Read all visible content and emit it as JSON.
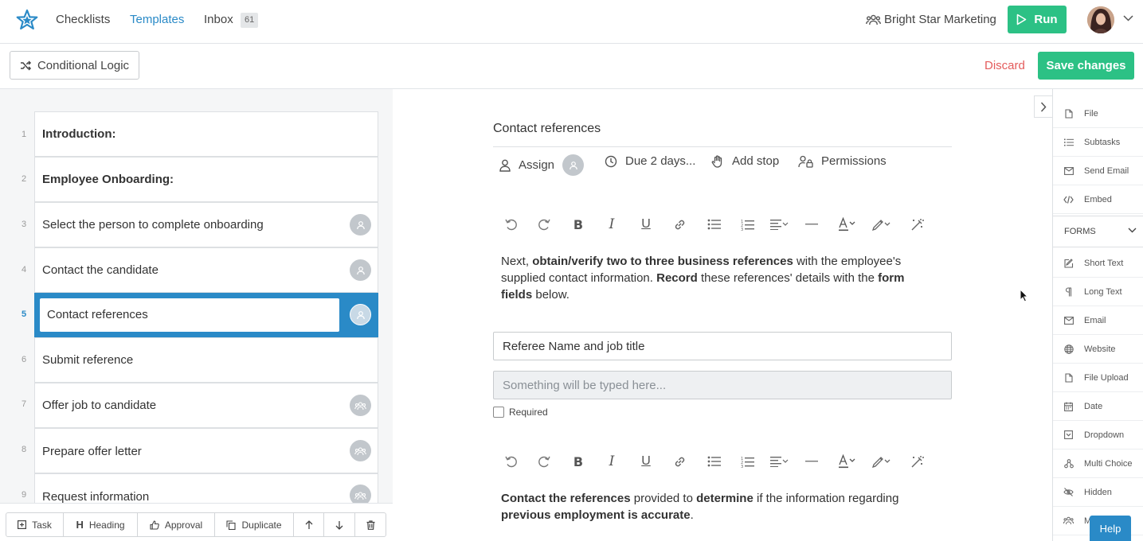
{
  "nav": {
    "links": [
      "Checklists",
      "Templates",
      "Inbox"
    ],
    "inbox_count": "61",
    "org_name": "Bright Star Marketing",
    "run_label": "Run"
  },
  "toolbar": {
    "conditional_logic_label": "Conditional Logic",
    "discard_label": "Discard",
    "save_label": "Save changes"
  },
  "outline": {
    "items": [
      {
        "number": "1",
        "label": "Introduction:",
        "heading": true,
        "assignee": "none"
      },
      {
        "number": "2",
        "label": "Employee Onboarding:",
        "heading": true,
        "assignee": "none"
      },
      {
        "number": "3",
        "label": "Select the person to complete onboarding",
        "heading": false,
        "assignee": "user"
      },
      {
        "number": "4",
        "label": "Contact the candidate",
        "heading": false,
        "assignee": "user"
      },
      {
        "number": "5",
        "label": "Contact references",
        "heading": false,
        "assignee": "user",
        "selected": true
      },
      {
        "number": "6",
        "label": "Submit reference",
        "heading": false,
        "assignee": "none"
      },
      {
        "number": "7",
        "label": "Offer job to candidate",
        "heading": false,
        "assignee": "group"
      },
      {
        "number": "8",
        "label": "Prepare offer letter",
        "heading": false,
        "assignee": "group"
      },
      {
        "number": "9",
        "label": "Request information",
        "heading": false,
        "assignee": "group"
      }
    ],
    "bottom_tools": [
      "Task",
      "Heading",
      "Approval",
      "Duplicate"
    ]
  },
  "editor": {
    "step_title": "Contact references",
    "meta": {
      "assign_label": "Assign",
      "due_label": "Due 2 days...",
      "stop_label": "Add stop",
      "permissions_label": "Permissions"
    },
    "block1": {
      "t1": "Next, ",
      "b1": "obtain/verify two to three business references",
      "t2": " with the employee's supplied contact information. ",
      "b2": "Record",
      "t3": " these references' details with the ",
      "b3": "form fields",
      "t4": " below."
    },
    "form_field": {
      "label": "Referee Name and job title",
      "placeholder": "Something will be typed here...",
      "required_label": "Required"
    },
    "block2": {
      "b1": "Contact the references",
      "t1": " provided to ",
      "b2": "determine",
      "t2": " if the information regarding ",
      "b3": "previous employment is accurate",
      "t3": "."
    }
  },
  "palette": {
    "content_items": [
      {
        "label": "File",
        "icon": "file-icon"
      },
      {
        "label": "Subtasks",
        "icon": "list-icon"
      },
      {
        "label": "Send Email",
        "icon": "mail-icon"
      },
      {
        "label": "Embed",
        "icon": "code-icon"
      }
    ],
    "forms_header": "FORMS",
    "form_items": [
      {
        "label": "Short Text",
        "icon": "edit-icon"
      },
      {
        "label": "Long Text",
        "icon": "paragraph-icon"
      },
      {
        "label": "Email",
        "icon": "mail-icon"
      },
      {
        "label": "Website",
        "icon": "globe-icon"
      },
      {
        "label": "File Upload",
        "icon": "file-icon"
      },
      {
        "label": "Date",
        "icon": "calendar-icon"
      },
      {
        "label": "Dropdown",
        "icon": "dropdown-icon"
      },
      {
        "label": "Multi Choice",
        "icon": "multi-choice-icon"
      },
      {
        "label": "Hidden",
        "icon": "eye-slash-icon"
      },
      {
        "label": "M",
        "icon": "users-icon"
      }
    ]
  },
  "help_label": "Help",
  "colors": {
    "accent_blue": "#2a8ac7",
    "brand_green": "#2cc185",
    "discard_red": "#e45b5b"
  }
}
